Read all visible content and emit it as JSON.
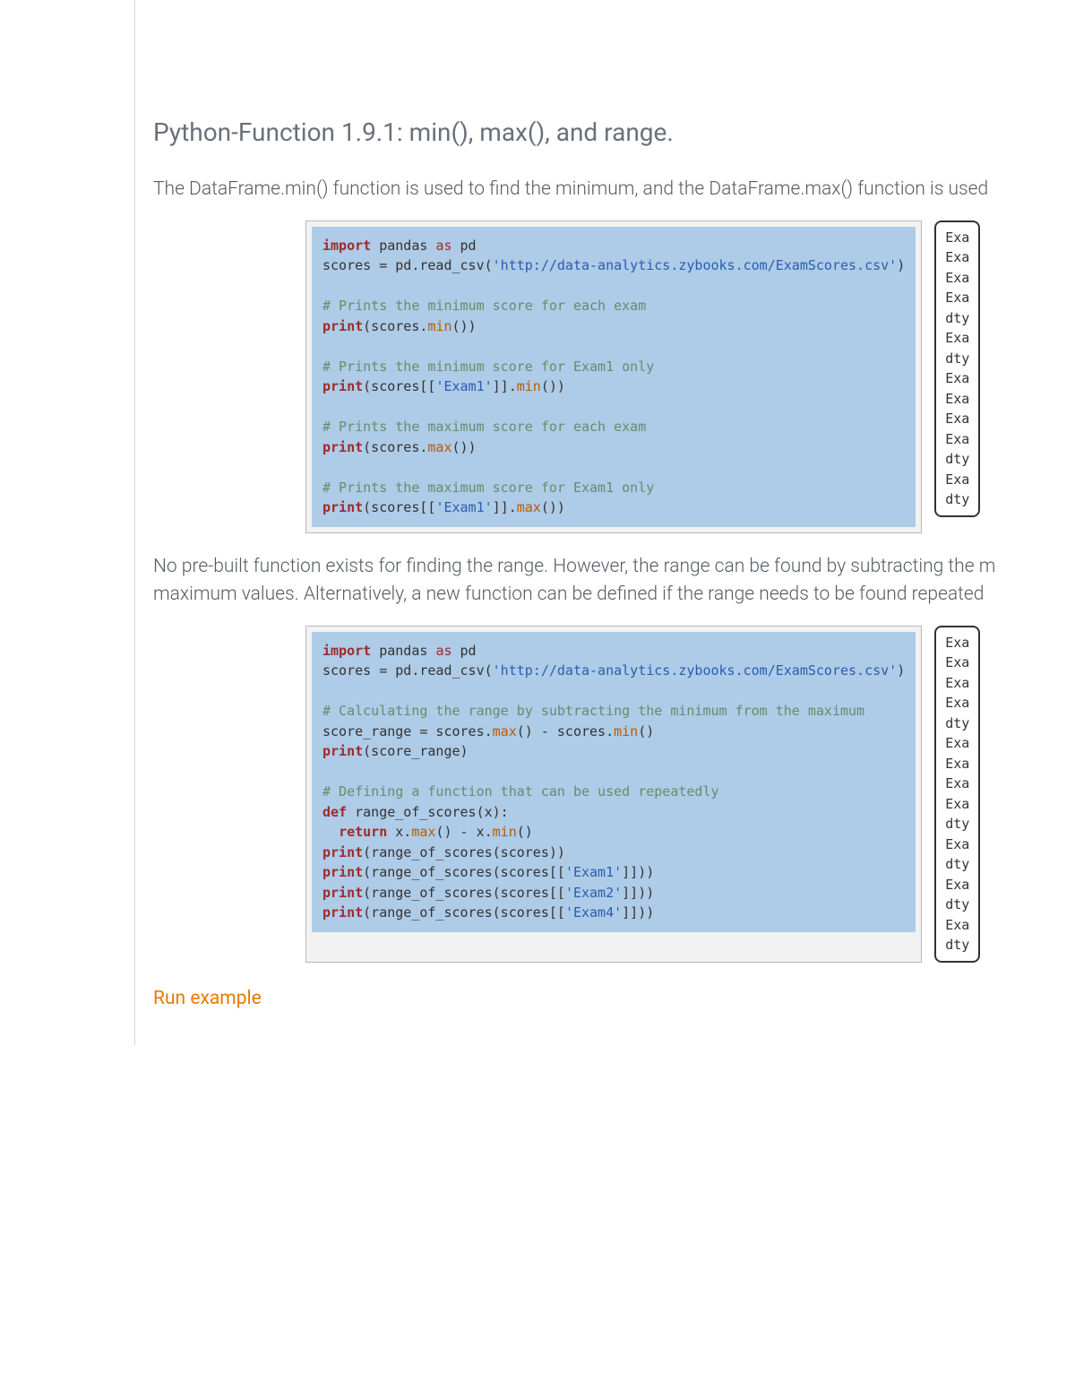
{
  "heading": "Python-Function 1.9.1: min(), max(), and range.",
  "para1": "The DataFrame.min() function is used to find the minimum, and the DataFrame.max() function is used",
  "para2a": "No pre-built function exists for finding the range. However, the range can be found by subtracting the m",
  "para2b": "maximum values. Alternatively, a new function can be defined if the range needs to be found repeated",
  "run_label": "Run example",
  "code1": {
    "l01a": "import",
    "l01b": " pandas ",
    "l01c": "as",
    "l01d": " pd",
    "l02a": "scores = pd.read_csv(",
    "l02b": "'http://data-analytics.zybooks.com/ExamScores.csv'",
    "l02c": ")",
    "blank": "",
    "l03": "# Prints the minimum score for each exam",
    "l04a": "print",
    "l04b": "(scores.",
    "l04c": "min",
    "l04d": "())",
    "l05": "# Prints the minimum score for Exam1 only",
    "l06a": "print",
    "l06b": "(scores[[",
    "l06c": "'Exam1'",
    "l06d": "]].",
    "l06e": "min",
    "l06f": "())",
    "l07": "# Prints the maximum score for each exam",
    "l08a": "print",
    "l08b": "(scores.",
    "l08c": "max",
    "l08d": "())",
    "l09": "# Prints the maximum score for Exam1 only",
    "l10a": "print",
    "l10b": "(scores[[",
    "l10c": "'Exam1'",
    "l10d": "]].",
    "l10e": "max",
    "l10f": "())"
  },
  "out1": {
    "l1": "Exa",
    "l2": "Exa",
    "l3": "Exa",
    "l4": "Exa",
    "l5": "dty",
    "l6": "Exa",
    "l7": "dty",
    "l8": "Exa",
    "l9": "Exa",
    "l10": "Exa",
    "l11": "Exa",
    "l12": "dty",
    "l13": "Exa",
    "l14": "dty"
  },
  "code2": {
    "l01a": "import",
    "l01b": " pandas ",
    "l01c": "as",
    "l01d": " pd",
    "l02a": "scores = pd.read_csv(",
    "l02b": "'http://data-analytics.zybooks.com/ExamScores.csv'",
    "l02c": ")",
    "blank": "",
    "l03": "# Calculating the range by subtracting the minimum from the maximum",
    "l04a": "score_range = scores.",
    "l04b": "max",
    "l04c": "() - scores.",
    "l04d": "min",
    "l04e": "()",
    "l05a": "print",
    "l05b": "(score_range)",
    "l06": "# Defining a function that can be used repeatedly",
    "l07a": "def",
    "l07b": " range_of_scores(x):",
    "l08a": "  ",
    "l08b": "return",
    "l08c": " x.",
    "l08d": "max",
    "l08e": "() - x.",
    "l08f": "min",
    "l08g": "()",
    "l09a": "print",
    "l09b": "(range_of_scores(scores))",
    "l10a": "print",
    "l10b": "(range_of_scores(scores[[",
    "l10c": "'Exam1'",
    "l10d": "]]))",
    "l11a": "print",
    "l11b": "(range_of_scores(scores[[",
    "l11c": "'Exam2'",
    "l11d": "]]))",
    "l12a": "print",
    "l12b": "(range_of_scores(scores[[",
    "l12c": "'Exam4'",
    "l12d": "]]))"
  },
  "out2": {
    "l1": "Exa",
    "l2": "Exa",
    "l3": "Exa",
    "l4": "Exa",
    "l5": "dty",
    "l6": "Exa",
    "l7": "Exa",
    "l8": "Exa",
    "l9": "Exa",
    "l10": "dty",
    "l11": "Exa",
    "l12": "dty",
    "l13": "Exa",
    "l14": "dty",
    "l15": "Exa",
    "l16": "dty"
  }
}
